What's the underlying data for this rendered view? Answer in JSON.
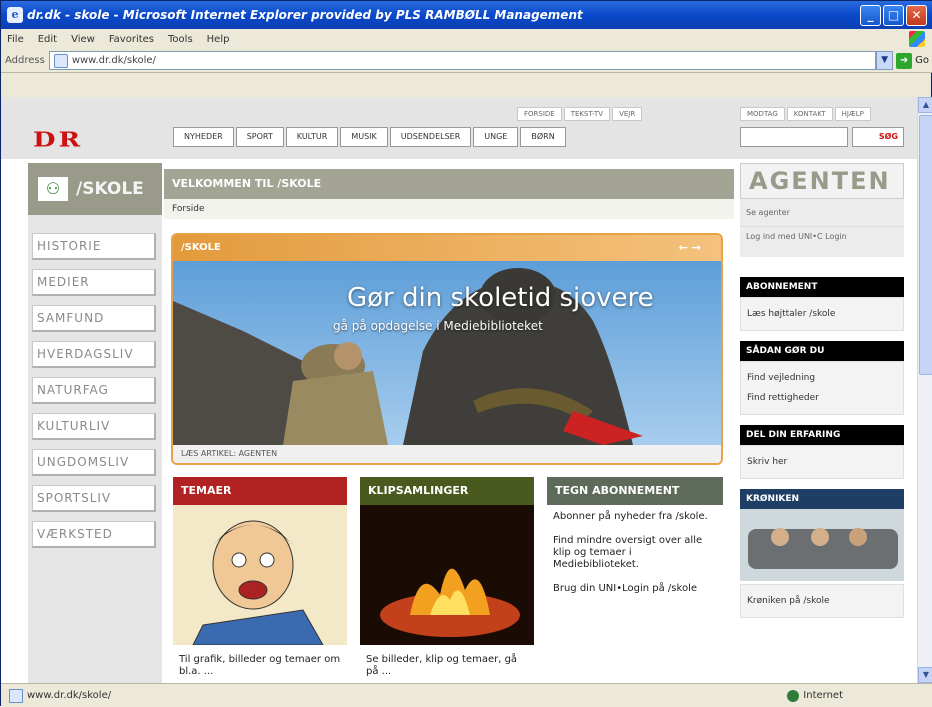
{
  "window": {
    "title": "dr.dk - skole - Microsoft Internet Explorer provided by PLS RAMBØLL Management",
    "buttons": {
      "minimize": "_",
      "maximize": "□",
      "close": "✕"
    }
  },
  "menubar": {
    "items": [
      "File",
      "Edit",
      "View",
      "Favorites",
      "Tools",
      "Help"
    ]
  },
  "addressbar": {
    "label": "Address",
    "url": "www.dr.dk/skole/",
    "go_label": "Go"
  },
  "statusbar": {
    "text": "www.dr.dk/skole/",
    "zone": "Internet"
  },
  "page": {
    "logo": "DR",
    "util_links": [
      "FORSIDE",
      "TEKST-TV",
      "VEJR",
      "MODTAG",
      "KONTAKT",
      "HJÆLP"
    ],
    "main_nav": [
      "NYHEDER",
      "SPORT",
      "KULTUR",
      "MUSIK",
      "UDSENDELSER",
      "UNGE",
      "BØRN"
    ],
    "search_button": "SØG",
    "section_logo": "/SKOLE",
    "side_nav": [
      "HISTORIE",
      "MEDIER",
      "SAMFUND",
      "HVERDAGSLIV",
      "NATURFAG",
      "KULTURLIV",
      "UNGDOMSLIV",
      "SPORTSLIV",
      "VÆRKSTED"
    ],
    "welcome": "VELKOMMEN TIL /SKOLE",
    "breadcrumb": "Forside",
    "feature": {
      "label": "/SKOLE",
      "nav_arrows": "← →",
      "headline": "Gør din skoletid sjovere",
      "subheadline": "gå på opdagelse i Mediebiblioteket",
      "caption": "LÆS ARTIKEL: AGENTEN"
    },
    "columns": [
      {
        "title": "TEMAER",
        "color": "#b22222",
        "text": "Til grafik, billeder og temaer om bl.a. ..."
      },
      {
        "title": "KLIPSAMLINGER",
        "color": "#4a5a1e",
        "text": "Se billeder, klip og temaer, gå på ..."
      },
      {
        "title": "TEGN ABONNEMENT",
        "color": "#5f6b5a",
        "text": "Abonner på nyheder fra /skole.\n\nFind mindre oversigt over alle klip og temaer i Mediebiblioteket.\n\nBrug din UNI•Login på /skole"
      }
    ],
    "agenten": {
      "logo": "AGENTEN",
      "row1": "Se agenter",
      "row2": "Log ind med UNI•C Login"
    },
    "right_boxes": [
      {
        "title": "ABONNEMENT",
        "body": "Læs højttaler /skole",
        "style": "black"
      },
      {
        "title": "SÅDAN GØR DU",
        "body": "Find vejledning\nFind rettigheder",
        "style": "black"
      },
      {
        "title": "DEL DIN ERFARING",
        "body": "Skriv her",
        "style": "black"
      },
      {
        "title": "KRØNIKEN",
        "body": "Krøniken på /skole",
        "style": "blue"
      }
    ]
  }
}
